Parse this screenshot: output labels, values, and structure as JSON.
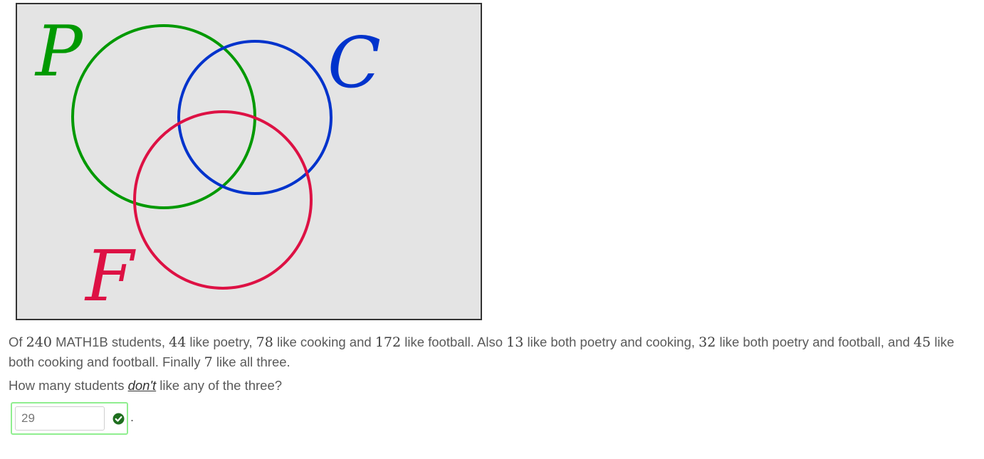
{
  "figure": {
    "type": "venn-diagram",
    "background_color": "#e4e4e4",
    "sets": [
      {
        "label": "P",
        "color": "#009900"
      },
      {
        "label": "C",
        "color": "#0033cc"
      },
      {
        "label": "F",
        "color": "#dd1144"
      }
    ]
  },
  "question": {
    "line1_parts": [
      "Of ",
      "240",
      " MATH1B students, ",
      "44",
      " like poetry, ",
      "78",
      " like cooking and ",
      "172",
      " like football. Also ",
      "13",
      " like both poetry and cooking, ",
      "32",
      " like both poetry and football, and ",
      "45",
      " like both cooking and football. Finally ",
      "7",
      " like all three."
    ],
    "ask_before": "How many students ",
    "ask_emphasis": "don't",
    "ask_after": " like any of the three?"
  },
  "answer": {
    "value": "29",
    "status": "correct",
    "status_icon": "check-circle-icon"
  },
  "trailing_text": "."
}
